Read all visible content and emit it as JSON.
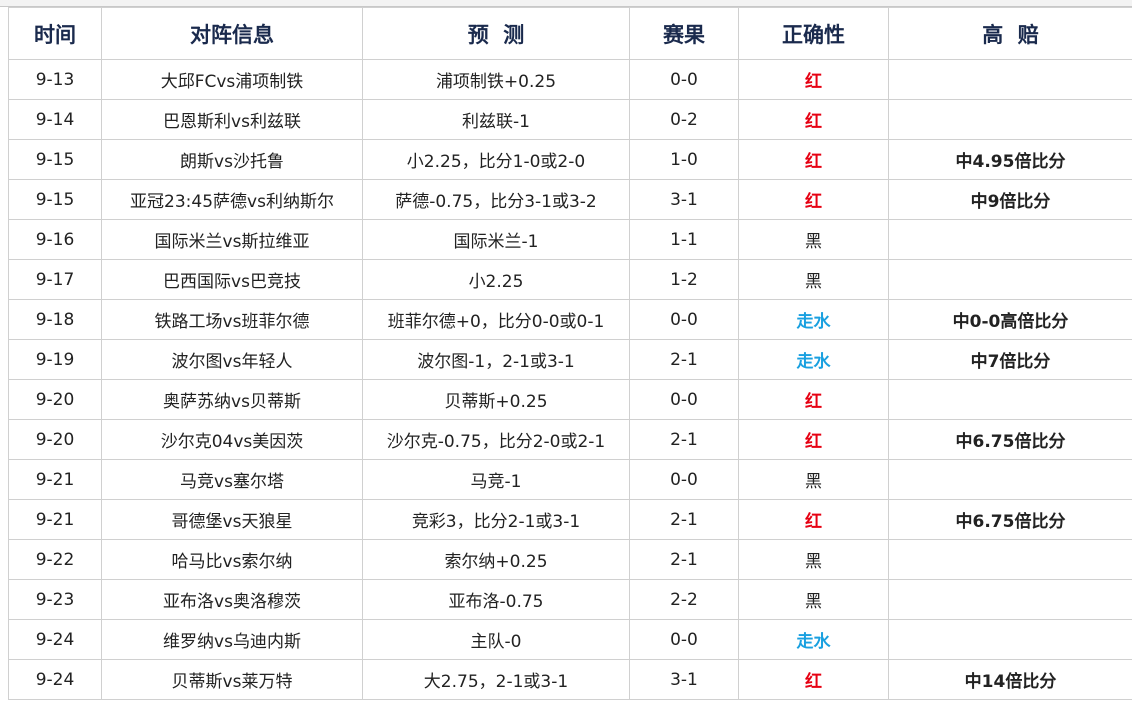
{
  "colors": {
    "header_text": "#1a2a4d",
    "score_text": "#e2231a",
    "red_result": "#e60012",
    "black_result": "#222222",
    "push_result": "#19a0e0",
    "high_odds": "#e60012"
  },
  "headers": [
    "时间",
    "对阵信息",
    "预  测",
    "赛果",
    "正确性",
    "高  赔"
  ],
  "rows": [
    {
      "time": "9-13",
      "match": "大邱FCvs浦项制铁",
      "prediction": "浦项制铁+0.25",
      "score": "0-0",
      "correct": "红",
      "result_type": "red",
      "high": ""
    },
    {
      "time": "9-14",
      "match": "巴恩斯利vs利兹联",
      "prediction": "利兹联-1",
      "score": "0-2",
      "correct": "红",
      "result_type": "red",
      "high": ""
    },
    {
      "time": "9-15",
      "match": "朗斯vs沙托鲁",
      "prediction": "小2.25，比分1-0或2-0",
      "score": "1-0",
      "correct": "红",
      "result_type": "red",
      "high": "中4.95倍比分"
    },
    {
      "time": "9-15",
      "match": "亚冠23:45萨德vs利纳斯尔",
      "prediction": "萨德-0.75，比分3-1或3-2",
      "score": "3-1",
      "correct": "红",
      "result_type": "red",
      "high": "中9倍比分"
    },
    {
      "time": "9-16",
      "match": "国际米兰vs斯拉维亚",
      "prediction": "国际米兰-1",
      "score": "1-1",
      "correct": "黑",
      "result_type": "black",
      "high": ""
    },
    {
      "time": "9-17",
      "match": "巴西国际vs巴竞技",
      "prediction": "小2.25",
      "score": "1-2",
      "correct": "黑",
      "result_type": "black",
      "high": ""
    },
    {
      "time": "9-18",
      "match": "铁路工场vs班菲尔德",
      "prediction": "班菲尔德+0，比分0-0或0-1",
      "score": "0-0",
      "correct": "走水",
      "result_type": "push",
      "high": "中0-0高倍比分"
    },
    {
      "time": "9-19",
      "match": "波尔图vs年轻人",
      "prediction": "波尔图-1，2-1或3-1",
      "score": "2-1",
      "correct": "走水",
      "result_type": "push",
      "high": "中7倍比分"
    },
    {
      "time": "9-20",
      "match": "奥萨苏纳vs贝蒂斯",
      "prediction": "贝蒂斯+0.25",
      "score": "0-0",
      "correct": "红",
      "result_type": "red",
      "high": ""
    },
    {
      "time": "9-20",
      "match": "沙尔克04vs美因茨",
      "prediction": "沙尔克-0.75，比分2-0或2-1",
      "score": "2-1",
      "correct": "红",
      "result_type": "red",
      "high": "中6.75倍比分"
    },
    {
      "time": "9-21",
      "match": "马竞vs塞尔塔",
      "prediction": "马竞-1",
      "score": "0-0",
      "correct": "黑",
      "result_type": "black",
      "high": ""
    },
    {
      "time": "9-21",
      "match": "哥德堡vs天狼星",
      "prediction": "竞彩3，比分2-1或3-1",
      "score": "2-1",
      "correct": "红",
      "result_type": "red",
      "high": "中6.75倍比分"
    },
    {
      "time": "9-22",
      "match": "哈马比vs索尔纳",
      "prediction": "索尔纳+0.25",
      "score": "2-1",
      "correct": "黑",
      "result_type": "black",
      "high": ""
    },
    {
      "time": "9-23",
      "match": "亚布洛vs奥洛穆茨",
      "prediction": "亚布洛-0.75",
      "score": "2-2",
      "correct": "黑",
      "result_type": "black",
      "high": ""
    },
    {
      "time": "9-24",
      "match": "维罗纳vs乌迪内斯",
      "prediction": "主队-0",
      "score": "0-0",
      "correct": "走水",
      "result_type": "push",
      "high": ""
    },
    {
      "time": "9-24",
      "match": "贝蒂斯vs莱万特",
      "prediction": "大2.75，2-1或3-1",
      "score": "3-1",
      "correct": "红",
      "result_type": "red",
      "high": "中14倍比分"
    }
  ]
}
